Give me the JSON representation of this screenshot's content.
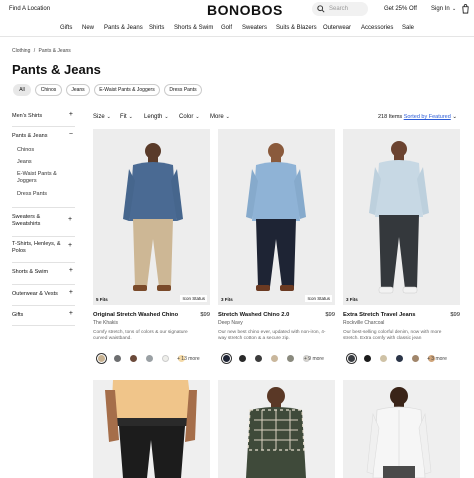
{
  "header": {
    "find_location": "Find A Location",
    "brand": "BONOBOS",
    "search_placeholder": "Search",
    "promo": "Get 25% Off",
    "sign_in": "Sign In"
  },
  "nav": [
    "Gifts",
    "New",
    "Pants & Jeans",
    "Shirts",
    "Shorts & Swim",
    "Golf",
    "Sweaters",
    "Suits & Blazers",
    "Outerwear",
    "Accessories",
    "Sale"
  ],
  "breadcrumb": {
    "parent": "Clothing",
    "sep": "/",
    "current": "Pants & Jeans"
  },
  "page_title": "Pants & Jeans",
  "chips": [
    "All",
    "Chinos",
    "Jeans",
    "E-Waist Pants & Joggers",
    "Dress Pants"
  ],
  "filters": [
    "Size",
    "Fit",
    "Length",
    "Color",
    "More"
  ],
  "results": {
    "count": "218 Items",
    "sort": "Sorted by Featured"
  },
  "sidebar": {
    "sections": [
      "Men's Shirts",
      "Pants & Jeans",
      "Sweaters & Sweatshirts",
      "T-Shirts, Henleys, & Polos",
      "Shorts & Swim",
      "Outerwear & Vests",
      "Gifts"
    ],
    "sub": [
      "Chinos",
      "Jeans",
      "E-Waist Pants & Joggers",
      "Dress Pants"
    ]
  },
  "products": [
    {
      "name": "Original Stretch Washed Chino",
      "price": "$99",
      "color": "The Khakis",
      "desc": "Comfy stretch, tons of colors & our signature curved waistband.",
      "fits": "5 Fits",
      "badge": "Icon Status",
      "more": "+ 13 more",
      "swatches": [
        "#c8b291",
        "#6d6e70",
        "#6b4a3a",
        "#9aa0a4",
        "#eeeeea",
        "#f4d9a6"
      ]
    },
    {
      "name": "Stretch Washed Chino 2.0",
      "price": "$99",
      "color": "Deep Navy",
      "desc": "Our new best chino ever, updated with non-iron, 4-way stretch cotton & a secure zip.",
      "fits": "3 Fits",
      "badge": "Icon Status",
      "more": "+ 9 more",
      "swatches": [
        "#1e2434",
        "#2a2a2a",
        "#3c3c3c",
        "#c9b79c",
        "#8a8a7e",
        "#d9d6cf"
      ]
    },
    {
      "name": "Extra Stretch Travel Jeans",
      "price": "$99",
      "color": "Rockville Charcoal",
      "desc": "Our best-selling colorful denim, now with more stretch. Extra comfy with classic jean",
      "fits": "3 Fits",
      "badge": "",
      "more": "+ 3 more",
      "swatches": [
        "#3a3d42",
        "#1c1c1c",
        "#cfc2a6",
        "#2b3548",
        "#a1866b",
        "#cfa47a"
      ]
    }
  ]
}
